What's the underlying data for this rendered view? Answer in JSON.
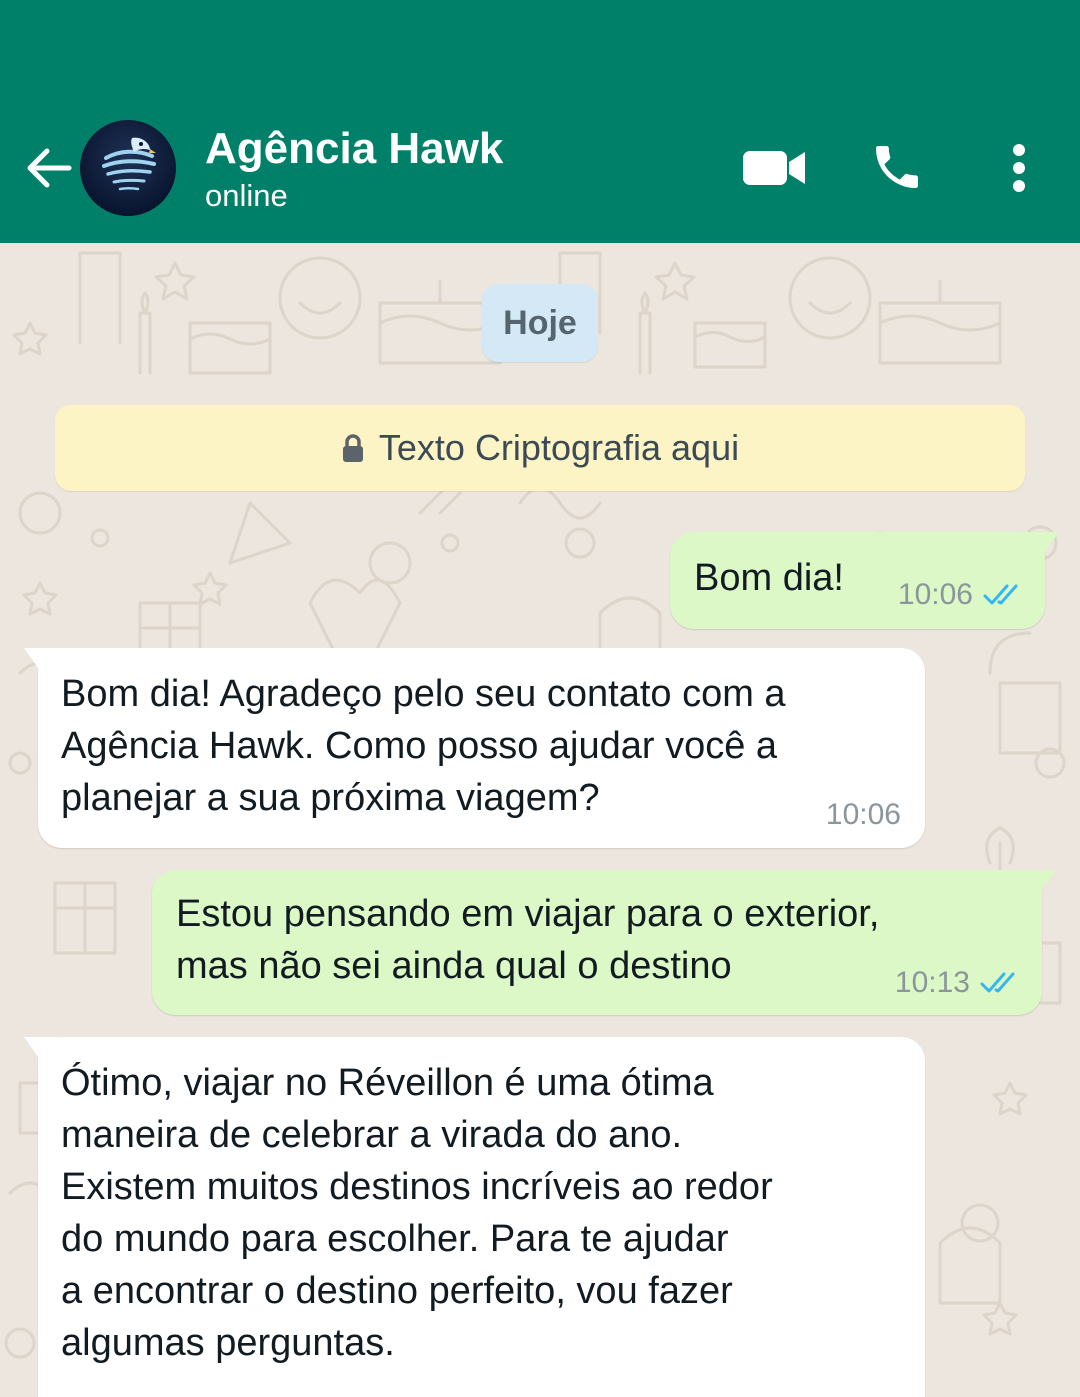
{
  "header": {
    "contact_name": "Agência Hawk",
    "status": "online",
    "background": "#008069",
    "icons": {
      "back": "back-arrow-icon",
      "video": "video-camera-icon",
      "call": "phone-icon",
      "menu": "more-vertical-icon"
    }
  },
  "chat": {
    "date_label": "Hoje",
    "encryption_notice": "Texto Criptografia aqui",
    "wallpaper_color": "#EDE6DE",
    "outgoing_color": "#DCF8C6",
    "incoming_color": "#FFFFFF",
    "read_tick_color": "#34B7F1",
    "messages": [
      {
        "direction": "outgoing",
        "text": "Bom dia!",
        "time": "10:06",
        "status": "read"
      },
      {
        "direction": "incoming",
        "text": "Bom dia! Agradeço pelo seu contato com a\nAgência Hawk. Como posso ajudar você a\nplanejar a sua próxima viagem?",
        "time": "10:06"
      },
      {
        "direction": "outgoing",
        "text": "Estou pensando em viajar para o exterior,\nmas não sei ainda qual o destino",
        "time": "10:13",
        "status": "read"
      },
      {
        "direction": "incoming",
        "text": "Ótimo, viajar no Réveillon é uma ótima\nmaneira de celebrar a virada do ano.\nExistem muitos destinos incríveis ao redor\ndo mundo para escolher. Para te ajudar\na encontrar o destino perfeito, vou fazer\nalgumas perguntas."
      }
    ]
  }
}
